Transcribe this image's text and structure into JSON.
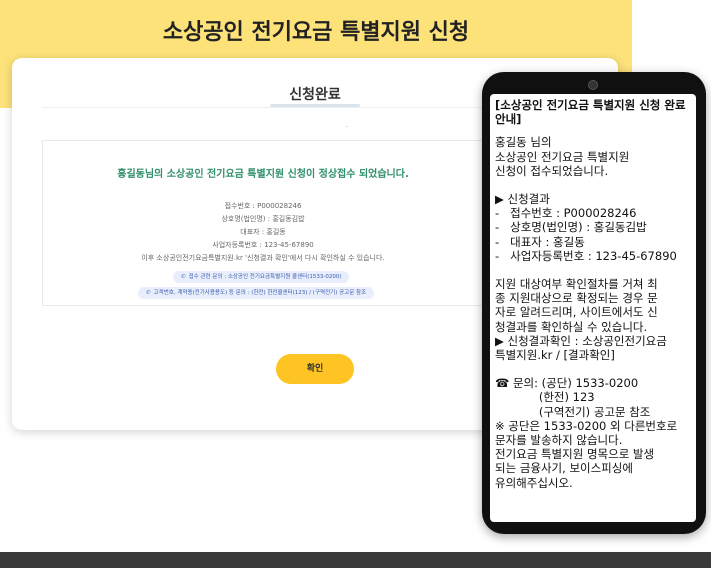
{
  "page": {
    "heading": "소상공인 전기요금 특별지원 신청"
  },
  "card": {
    "title": "신청완료",
    "dot": ".",
    "success_message": "홍길동님의 소상공인 전기요금 특별지원 신청이 정상접수 되었습니다.",
    "info_lines": [
      "접수번호 : P000028246",
      "상호명(법인명) : 홍길동김밥",
      "대표자 : 홍길동",
      "사업자등록번호 : 123-45-67890",
      "이후 소상공인전기요금특별지원.kr '신청결과 확인'에서 다시 확인하실 수 있습니다."
    ],
    "pill_1": "접수 관련 문의 : 소상공인 전기요금특별지원 콜센터(1533-0200)",
    "pill_2": "고객번호, 계약종(전기사용용도) 등 문의 : (한전) 한전콜센터(123) / (구역전기) 공고문 참조",
    "confirm_button": "확인"
  },
  "icons": {
    "phone_icon": "phone-icon",
    "camera": "camera-icon"
  },
  "sms": {
    "title": "[소상공인 전기요금 특별지원 신청 완료 안내]",
    "greeting": [
      "홍길동 님의",
      "소상공인 전기요금 특별지원",
      "신청이 접수되었습니다."
    ],
    "result_header": "▶ 신청결과",
    "result_lines": [
      "-   접수번호 : P000028246",
      "-   상호명(법인명) : 홍길동김밥",
      "-   대표자 : 홍길동",
      "-   사업자등록번호 : 123-45-67890"
    ],
    "notice": [
      "지원 대상여부 확인절차를 거쳐 최",
      "종 지원대상으로 확정되는 경우 문",
      "자로 알려드리며, 사이트에서도 신",
      "청결과를 확인하실 수 있습니다."
    ],
    "check_lines": [
      "▶ 신청결과확인 : 소상공인전기요금",
      "특별지원.kr / [결과확인]"
    ],
    "contact_lines": [
      "☎ 문의: (공단) 1533-0200",
      "            (한전) 123",
      "            (구역전기) 공고문 참조"
    ],
    "warning_lines": [
      "※ 공단은 1533-0200 외 다른번호로",
      "문자를 발송하지 않습니다.",
      "전기요금 특별지원 명목으로 발생",
      "되는 금융사기, 보이스피싱에",
      "유의해주십시오."
    ]
  }
}
